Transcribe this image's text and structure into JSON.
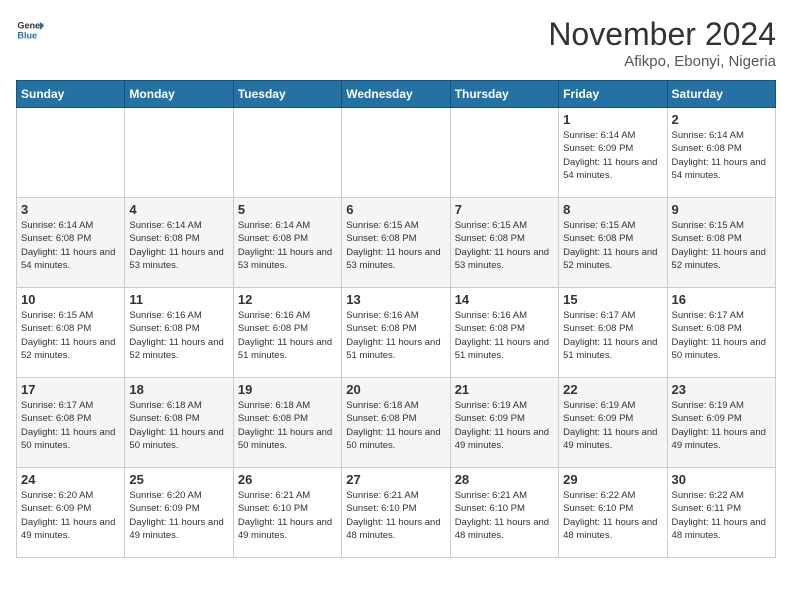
{
  "header": {
    "logo_line1": "General",
    "logo_line2": "Blue",
    "month_title": "November 2024",
    "location": "Afikpo, Ebonyi, Nigeria"
  },
  "days_of_week": [
    "Sunday",
    "Monday",
    "Tuesday",
    "Wednesday",
    "Thursday",
    "Friday",
    "Saturday"
  ],
  "weeks": [
    [
      {
        "day": "",
        "sunrise": "",
        "sunset": "",
        "daylight": ""
      },
      {
        "day": "",
        "sunrise": "",
        "sunset": "",
        "daylight": ""
      },
      {
        "day": "",
        "sunrise": "",
        "sunset": "",
        "daylight": ""
      },
      {
        "day": "",
        "sunrise": "",
        "sunset": "",
        "daylight": ""
      },
      {
        "day": "",
        "sunrise": "",
        "sunset": "",
        "daylight": ""
      },
      {
        "day": "1",
        "sunrise": "Sunrise: 6:14 AM",
        "sunset": "Sunset: 6:09 PM",
        "daylight": "Daylight: 11 hours and 54 minutes."
      },
      {
        "day": "2",
        "sunrise": "Sunrise: 6:14 AM",
        "sunset": "Sunset: 6:08 PM",
        "daylight": "Daylight: 11 hours and 54 minutes."
      }
    ],
    [
      {
        "day": "3",
        "sunrise": "Sunrise: 6:14 AM",
        "sunset": "Sunset: 6:08 PM",
        "daylight": "Daylight: 11 hours and 54 minutes."
      },
      {
        "day": "4",
        "sunrise": "Sunrise: 6:14 AM",
        "sunset": "Sunset: 6:08 PM",
        "daylight": "Daylight: 11 hours and 53 minutes."
      },
      {
        "day": "5",
        "sunrise": "Sunrise: 6:14 AM",
        "sunset": "Sunset: 6:08 PM",
        "daylight": "Daylight: 11 hours and 53 minutes."
      },
      {
        "day": "6",
        "sunrise": "Sunrise: 6:15 AM",
        "sunset": "Sunset: 6:08 PM",
        "daylight": "Daylight: 11 hours and 53 minutes."
      },
      {
        "day": "7",
        "sunrise": "Sunrise: 6:15 AM",
        "sunset": "Sunset: 6:08 PM",
        "daylight": "Daylight: 11 hours and 53 minutes."
      },
      {
        "day": "8",
        "sunrise": "Sunrise: 6:15 AM",
        "sunset": "Sunset: 6:08 PM",
        "daylight": "Daylight: 11 hours and 52 minutes."
      },
      {
        "day": "9",
        "sunrise": "Sunrise: 6:15 AM",
        "sunset": "Sunset: 6:08 PM",
        "daylight": "Daylight: 11 hours and 52 minutes."
      }
    ],
    [
      {
        "day": "10",
        "sunrise": "Sunrise: 6:15 AM",
        "sunset": "Sunset: 6:08 PM",
        "daylight": "Daylight: 11 hours and 52 minutes."
      },
      {
        "day": "11",
        "sunrise": "Sunrise: 6:16 AM",
        "sunset": "Sunset: 6:08 PM",
        "daylight": "Daylight: 11 hours and 52 minutes."
      },
      {
        "day": "12",
        "sunrise": "Sunrise: 6:16 AM",
        "sunset": "Sunset: 6:08 PM",
        "daylight": "Daylight: 11 hours and 51 minutes."
      },
      {
        "day": "13",
        "sunrise": "Sunrise: 6:16 AM",
        "sunset": "Sunset: 6:08 PM",
        "daylight": "Daylight: 11 hours and 51 minutes."
      },
      {
        "day": "14",
        "sunrise": "Sunrise: 6:16 AM",
        "sunset": "Sunset: 6:08 PM",
        "daylight": "Daylight: 11 hours and 51 minutes."
      },
      {
        "day": "15",
        "sunrise": "Sunrise: 6:17 AM",
        "sunset": "Sunset: 6:08 PM",
        "daylight": "Daylight: 11 hours and 51 minutes."
      },
      {
        "day": "16",
        "sunrise": "Sunrise: 6:17 AM",
        "sunset": "Sunset: 6:08 PM",
        "daylight": "Daylight: 11 hours and 50 minutes."
      }
    ],
    [
      {
        "day": "17",
        "sunrise": "Sunrise: 6:17 AM",
        "sunset": "Sunset: 6:08 PM",
        "daylight": "Daylight: 11 hours and 50 minutes."
      },
      {
        "day": "18",
        "sunrise": "Sunrise: 6:18 AM",
        "sunset": "Sunset: 6:08 PM",
        "daylight": "Daylight: 11 hours and 50 minutes."
      },
      {
        "day": "19",
        "sunrise": "Sunrise: 6:18 AM",
        "sunset": "Sunset: 6:08 PM",
        "daylight": "Daylight: 11 hours and 50 minutes."
      },
      {
        "day": "20",
        "sunrise": "Sunrise: 6:18 AM",
        "sunset": "Sunset: 6:08 PM",
        "daylight": "Daylight: 11 hours and 50 minutes."
      },
      {
        "day": "21",
        "sunrise": "Sunrise: 6:19 AM",
        "sunset": "Sunset: 6:09 PM",
        "daylight": "Daylight: 11 hours and 49 minutes."
      },
      {
        "day": "22",
        "sunrise": "Sunrise: 6:19 AM",
        "sunset": "Sunset: 6:09 PM",
        "daylight": "Daylight: 11 hours and 49 minutes."
      },
      {
        "day": "23",
        "sunrise": "Sunrise: 6:19 AM",
        "sunset": "Sunset: 6:09 PM",
        "daylight": "Daylight: 11 hours and 49 minutes."
      }
    ],
    [
      {
        "day": "24",
        "sunrise": "Sunrise: 6:20 AM",
        "sunset": "Sunset: 6:09 PM",
        "daylight": "Daylight: 11 hours and 49 minutes."
      },
      {
        "day": "25",
        "sunrise": "Sunrise: 6:20 AM",
        "sunset": "Sunset: 6:09 PM",
        "daylight": "Daylight: 11 hours and 49 minutes."
      },
      {
        "day": "26",
        "sunrise": "Sunrise: 6:21 AM",
        "sunset": "Sunset: 6:10 PM",
        "daylight": "Daylight: 11 hours and 49 minutes."
      },
      {
        "day": "27",
        "sunrise": "Sunrise: 6:21 AM",
        "sunset": "Sunset: 6:10 PM",
        "daylight": "Daylight: 11 hours and 48 minutes."
      },
      {
        "day": "28",
        "sunrise": "Sunrise: 6:21 AM",
        "sunset": "Sunset: 6:10 PM",
        "daylight": "Daylight: 11 hours and 48 minutes."
      },
      {
        "day": "29",
        "sunrise": "Sunrise: 6:22 AM",
        "sunset": "Sunset: 6:10 PM",
        "daylight": "Daylight: 11 hours and 48 minutes."
      },
      {
        "day": "30",
        "sunrise": "Sunrise: 6:22 AM",
        "sunset": "Sunset: 6:11 PM",
        "daylight": "Daylight: 11 hours and 48 minutes."
      }
    ]
  ]
}
